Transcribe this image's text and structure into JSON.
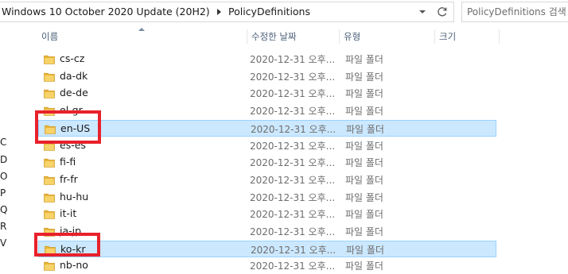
{
  "address_bar": {
    "segments": [
      "Windows 10 October 2020 Update (20H2)",
      "PolicyDefinitions"
    ]
  },
  "search": {
    "placeholder": "PolicyDefinitions 검색"
  },
  "nav_pane": {
    "letters": [
      "C",
      "D",
      "O",
      "P",
      "Q",
      "R",
      "V"
    ]
  },
  "columns": {
    "name": "이름",
    "date_modified": "수정한 날짜",
    "type": "유형",
    "size": "크기"
  },
  "files": [
    {
      "name": "cs-cz",
      "date": "2020-12-31 오후...",
      "type": "파일 폴더",
      "selected": false
    },
    {
      "name": "da-dk",
      "date": "2020-12-31 오후...",
      "type": "파일 폴더",
      "selected": false
    },
    {
      "name": "de-de",
      "date": "2020-12-31 오후...",
      "type": "파일 폴더",
      "selected": false
    },
    {
      "name": "el-gr",
      "date": "2020-12-31 오후...",
      "type": "파일 폴더",
      "selected": false
    },
    {
      "name": "en-US",
      "date": "2020-12-31 오후...",
      "type": "파일 폴더",
      "selected": true
    },
    {
      "name": "es-es",
      "date": "2020-12-31 오후...",
      "type": "파일 폴더",
      "selected": false
    },
    {
      "name": "fi-fi",
      "date": "2020-12-31 오후...",
      "type": "파일 폴더",
      "selected": false
    },
    {
      "name": "fr-fr",
      "date": "2020-12-31 오후...",
      "type": "파일 폴더",
      "selected": false
    },
    {
      "name": "hu-hu",
      "date": "2020-12-31 오후...",
      "type": "파일 폴더",
      "selected": false
    },
    {
      "name": "it-it",
      "date": "2020-12-31 오후...",
      "type": "파일 폴더",
      "selected": false
    },
    {
      "name": "ja-jp",
      "date": "2020-12-31 오후...",
      "type": "파일 폴더",
      "selected": false
    },
    {
      "name": "ko-kr",
      "date": "2020-12-31 오후...",
      "type": "파일 폴더",
      "selected": true
    },
    {
      "name": "nb-no",
      "date": "2020-12-31 오후...",
      "type": "파일 폴더",
      "selected": false
    }
  ],
  "colors": {
    "selection_fill": "#cce8ff",
    "selection_border": "#99d1ff",
    "highlight_red": "#e8212b",
    "folder_yellow": "#f5c542"
  },
  "icons": {
    "folder": "folder-icon",
    "refresh": "refresh-icon",
    "breadcrumb_separator": "chevron-right-icon",
    "dropdown": "chevron-down-icon",
    "sort": "sort-ascending-icon"
  }
}
